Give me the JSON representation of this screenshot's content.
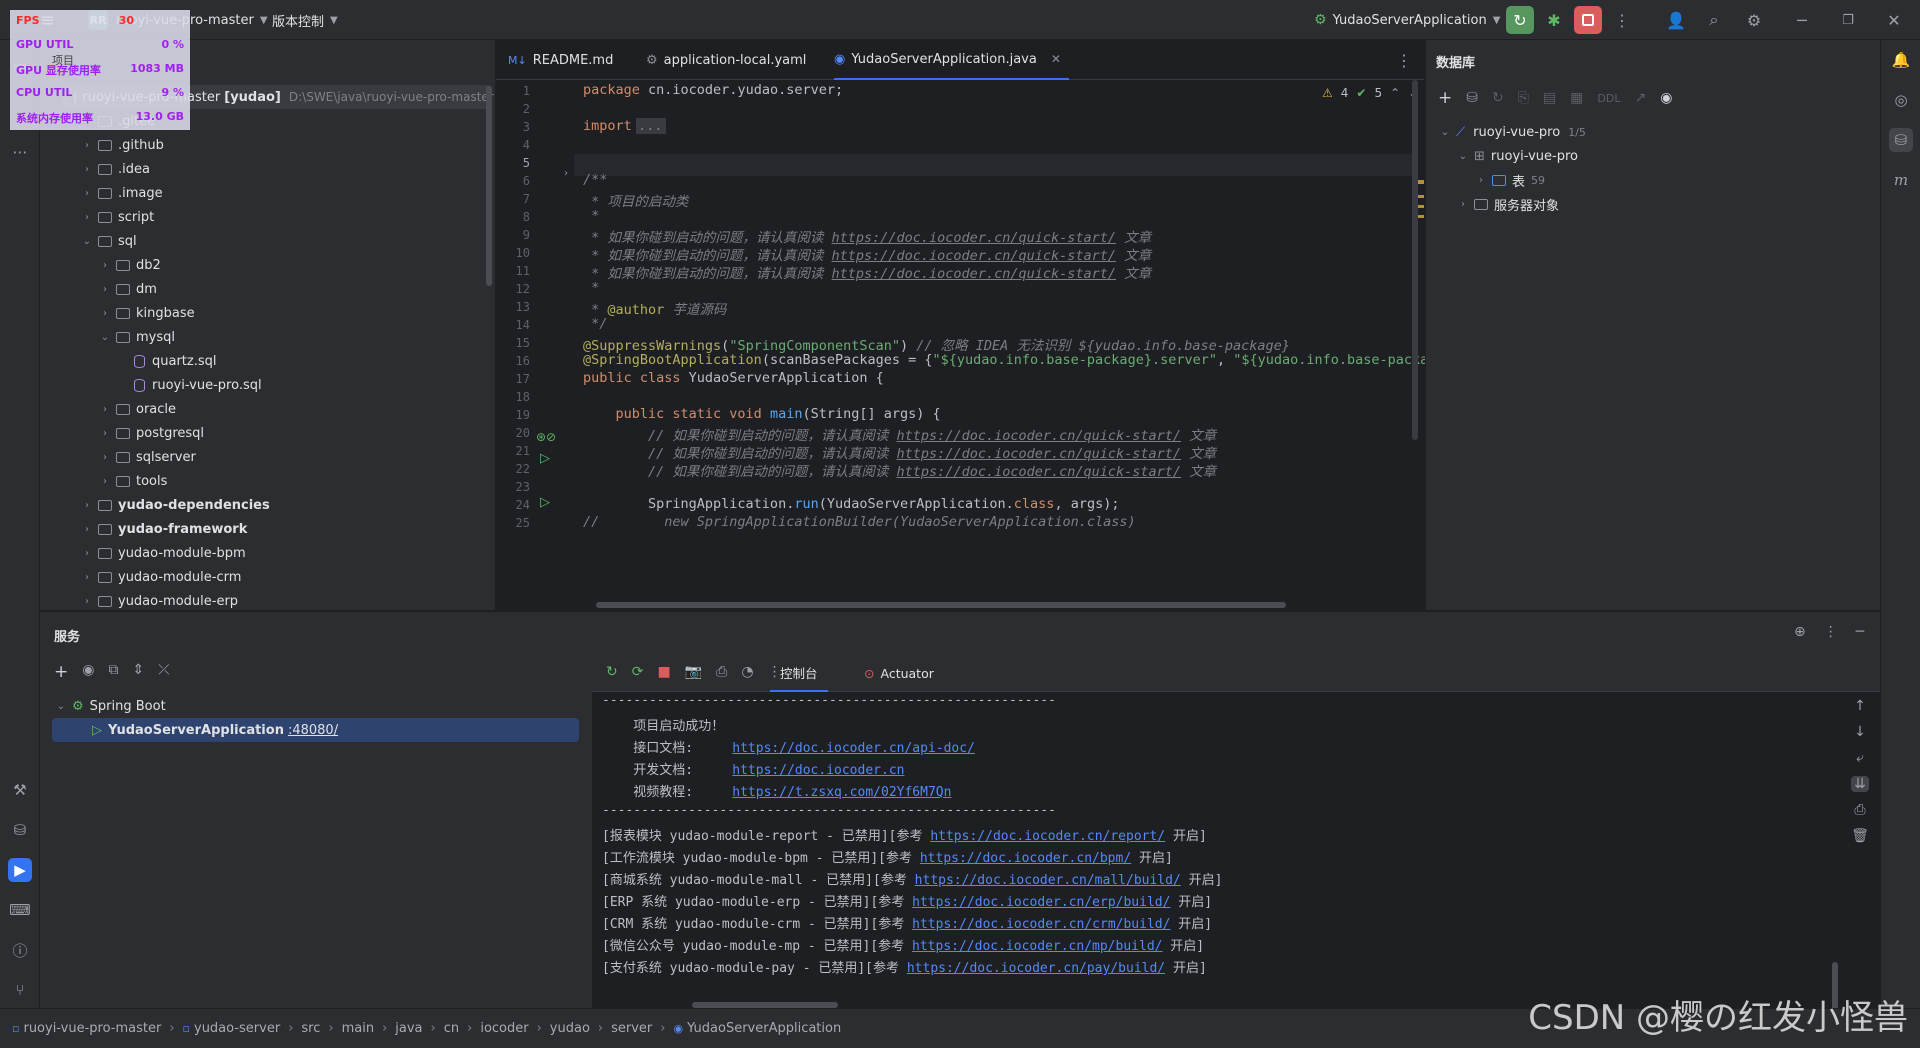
{
  "titlebar": {
    "project_badge": "RR",
    "project_name": "ruoyi-vue-pro-master",
    "vcs_label": "版本控制",
    "run_config": "YudaoServerApplication"
  },
  "perf": {
    "fps_label": "FPS",
    "fps_value": "30",
    "gpu_util_label": "GPU UTIL",
    "gpu_util_value": "0 %",
    "gpu_mem_label": "GPU 显存使用率",
    "gpu_mem_value": "1083 MB",
    "cpu_util_label": "CPU UTIL",
    "cpu_util_value": "9 %",
    "sys_mem_label": "系统内存使用率",
    "sys_mem_value": "13.0 GB"
  },
  "project": {
    "title": "项目",
    "root_name": "ruoyi-vue-pro-master",
    "root_module": "[yudao]",
    "root_path": "D:\\SWE\\java\\ruoyi-vue-pro-master",
    "items": [
      {
        "label": ".gitee",
        "indent": 1
      },
      {
        "label": ".github",
        "indent": 1
      },
      {
        "label": ".idea",
        "indent": 1
      },
      {
        "label": ".image",
        "indent": 1
      },
      {
        "label": "script",
        "indent": 1
      },
      {
        "label": "sql",
        "indent": 1,
        "open": true
      },
      {
        "label": "db2",
        "indent": 2
      },
      {
        "label": "dm",
        "indent": 2
      },
      {
        "label": "kingbase",
        "indent": 2
      },
      {
        "label": "mysql",
        "indent": 2,
        "open": true
      },
      {
        "label": "quartz.sql",
        "indent": 3,
        "file": true
      },
      {
        "label": "ruoyi-vue-pro.sql",
        "indent": 3,
        "file": true
      },
      {
        "label": "oracle",
        "indent": 2
      },
      {
        "label": "postgresql",
        "indent": 2
      },
      {
        "label": "sqlserver",
        "indent": 2
      },
      {
        "label": "tools",
        "indent": 2
      },
      {
        "label": "yudao-dependencies",
        "indent": 1,
        "bold": true
      },
      {
        "label": "yudao-framework",
        "indent": 1,
        "bold": true
      },
      {
        "label": "yudao-module-bpm",
        "indent": 1
      },
      {
        "label": "yudao-module-crm",
        "indent": 1
      },
      {
        "label": "yudao-module-erp",
        "indent": 1
      }
    ]
  },
  "editor": {
    "tabs": [
      {
        "label": "README.md",
        "prefix": "M↓"
      },
      {
        "label": "application-local.yaml"
      },
      {
        "label": "YudaoServerApplication.java",
        "active": true
      }
    ],
    "warnings": "4",
    "oks": "5",
    "line_numbers": [
      "1",
      "2",
      "3",
      "4",
      "5",
      "6",
      "7",
      "8",
      "9",
      "10",
      "11",
      "12",
      "13",
      "14",
      "15",
      "16",
      "17",
      "18",
      "19",
      "20",
      "21",
      "22",
      "23",
      "24",
      "25"
    ],
    "code": {
      "l1_kw": "package",
      "l1_rest": " cn.iocoder.yudao.server;",
      "l3_kw": "import",
      "l3_rest": "...",
      "l6": "/**",
      "l7": " * 项目的启动类",
      "l8": " *",
      "l9_pre": " * 如果你碰到启动的问题，请认真阅读 ",
      "l9_link": "https://doc.iocoder.cn/quick-start/",
      "l9_post": " 文章",
      "l10_pre": " * 如果你碰到启动的问题，请认真阅读 ",
      "l10_link": "https://doc.iocoder.cn/quick-start/",
      "l10_post": " 文章",
      "l11_pre": " * 如果你碰到启动的问题，请认真阅读 ",
      "l11_link": "https://doc.iocoder.cn/quick-start/",
      "l11_post": " 文章",
      "l12": " *",
      "l13_pre": " * ",
      "l13_tag": "@author",
      "l13_post": " 芋道源码",
      "l14": " */",
      "l15_an": "@SuppressWarnings",
      "l15_p1": "(",
      "l15_str": "\"SpringComponentScan\"",
      "l15_p2": ") ",
      "l15_cm": "// 忽略 IDEA 无法识别 ${yudao.info.base-package}",
      "l16_an": "@SpringBootApplication",
      "l16_rest": "(scanBasePackages = {",
      "l16_s1": "\"${yudao.info.base-package}.server\"",
      "l16_c": ", ",
      "l16_s2": "\"${yudao.info.base-packag",
      "l17_kw": "public class",
      "l17_rest": " YudaoServerApplication {",
      "l19_kw": "    public static void",
      "l19_fn": " main",
      "l19_rest": "(String[] args) {",
      "l20_pre": "        // 如果你碰到启动的问题，请认真阅读 ",
      "l20_link": "https://doc.iocoder.cn/quick-start/",
      "l20_post": " 文章",
      "l21_pre": "        // 如果你碰到启动的问题，请认真阅读 ",
      "l21_link": "https://doc.iocoder.cn/quick-start/",
      "l21_post": " 文章",
      "l22_pre": "        // 如果你碰到启动的问题，请认真阅读 ",
      "l22_link": "https://doc.iocoder.cn/quick-start/",
      "l22_post": " 文章",
      "l24_pre": "        SpringApplication.",
      "l24_fn": "run",
      "l24_mid": "(YudaoServerApplication.",
      "l24_kw": "class",
      "l24_post": ", args);",
      "l25": "//        new SpringApplicationBuilder(YudaoServerApplication.class)"
    }
  },
  "database": {
    "title": "数据库",
    "ddl_label": "DDL",
    "tree": [
      {
        "label": "ruoyi-vue-pro",
        "badge": "1/5"
      },
      {
        "label": "ruoyi-vue-pro"
      },
      {
        "label": "表",
        "badge": "59"
      },
      {
        "label": "服务器对象"
      }
    ]
  },
  "services": {
    "title": "服务",
    "tab_console": "控制台",
    "tab_actuator": "Actuator",
    "tree_root": "Spring Boot",
    "app_name": "YudaoServerApplication",
    "app_port": ":48080/",
    "console": {
      "sep": "----------------------------------------------------------",
      "started": "    项目启动成功！",
      "api_label": "    接口文档:     ",
      "api_link": "https://doc.iocoder.cn/api-doc/",
      "dev_label": "    开发文档:     ",
      "dev_link": "https://doc.iocoder.cn",
      "video_label": "    视频教程:     ",
      "video_link": "https://t.zsxq.com/02Yf6M7Qn",
      "modules": [
        {
          "pre": "[报表模块 yudao-module-report - 已禁用][参考 ",
          "link": "https://doc.iocoder.cn/report/",
          "post": " 开启]"
        },
        {
          "pre": "[工作流模块 yudao-module-bpm - 已禁用][参考 ",
          "link": "https://doc.iocoder.cn/bpm/",
          "post": " 开启]"
        },
        {
          "pre": "[商城系统 yudao-module-mall - 已禁用][参考 ",
          "link": "https://doc.iocoder.cn/mall/build/",
          "post": " 开启]"
        },
        {
          "pre": "[ERP 系统 yudao-module-erp - 已禁用][参考 ",
          "link": "https://doc.iocoder.cn/erp/build/",
          "post": " 开启]"
        },
        {
          "pre": "[CRM 系统 yudao-module-crm - 已禁用][参考 ",
          "link": "https://doc.iocoder.cn/crm/build/",
          "post": " 开启]"
        },
        {
          "pre": "[微信公众号 yudao-module-mp - 已禁用][参考 ",
          "link": "https://doc.iocoder.cn/mp/build/",
          "post": " 开启]"
        },
        {
          "pre": "[支付系统 yudao-module-pay - 已禁用][参考 ",
          "link": "https://doc.iocoder.cn/pay/build/",
          "post": " 开启]"
        }
      ]
    }
  },
  "statusbar": {
    "crumbs": [
      "ruoyi-vue-pro-master",
      "yudao-server",
      "src",
      "main",
      "java",
      "cn",
      "iocoder",
      "yudao",
      "server",
      "YudaoServerApplication"
    ]
  },
  "watermark": "CSDN @樱の红发小怪兽"
}
